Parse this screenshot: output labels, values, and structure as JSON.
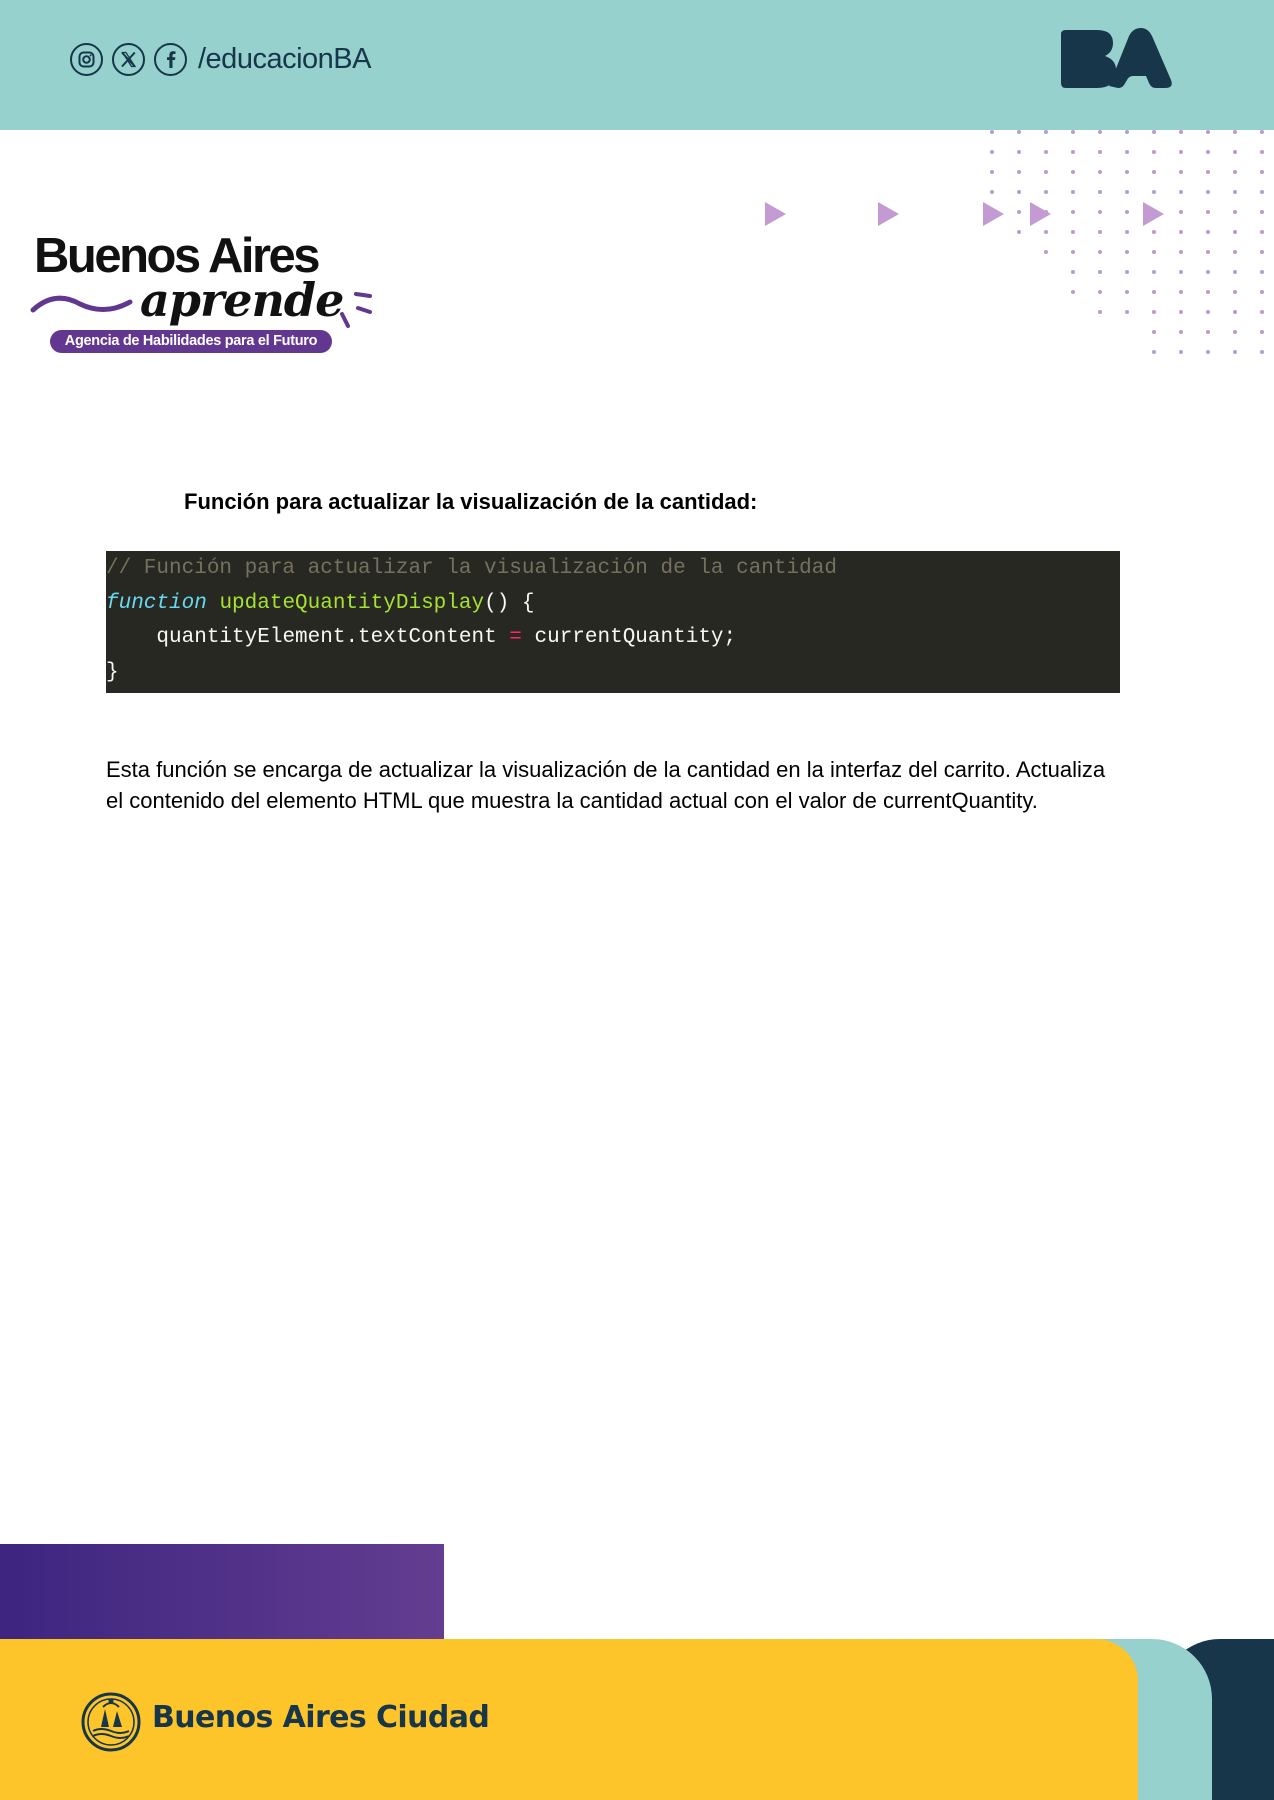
{
  "header": {
    "social_icons": [
      "instagram-icon",
      "x-icon",
      "facebook-icon"
    ],
    "social_handle": "/educacionBA",
    "logo_text": "BA"
  },
  "brand": {
    "title": "Buenos Aires",
    "script": "aprende",
    "tagline": "Agencia de Habilidades para el Futuro"
  },
  "content": {
    "heading": "Función para actualizar la visualización de la cantidad:",
    "code": {
      "comment": "// Función para actualizar la visualización de la cantidad",
      "keyword": "function",
      "function_name": "updateQuantityDisplay",
      "signature_rest": "() {",
      "body_indent": "    ",
      "body_left": "quantityElement.textContent ",
      "body_operator": "=",
      "body_right": " currentQuantity;",
      "closing": "}"
    },
    "paragraph": "Esta función se encarga de actualizar la visualización de la cantidad en la interfaz del carrito. Actualiza el contenido del elemento HTML que muestra la cantidad actual con el valor de currentQuantity."
  },
  "footer": {
    "brand": "Buenos Aires Ciudad"
  },
  "colors": {
    "teal": "#97d1cd",
    "navy": "#17364a",
    "purple": "#62378f",
    "yellow": "#fec52b",
    "code_bg": "#272822"
  }
}
